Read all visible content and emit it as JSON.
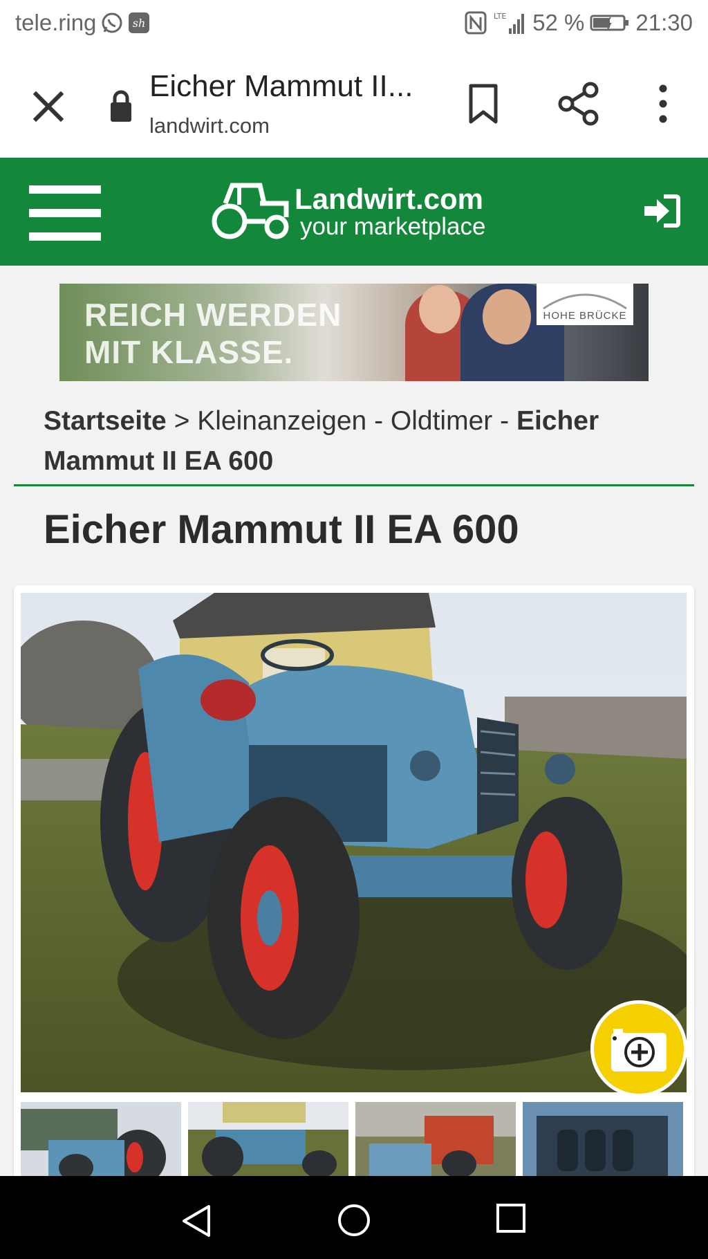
{
  "status_bar": {
    "carrier": "tele.ring",
    "battery": "52 %",
    "time": "21:30",
    "network": "LTE"
  },
  "browser": {
    "title": "Eicher Mammut II...",
    "host": "landwirt.com"
  },
  "site": {
    "logo_name": "Landwirt.com",
    "logo_tagline": "your marketplace",
    "brand_color": "#13883a"
  },
  "ad": {
    "headline_line1": "REICH WERDEN",
    "headline_line2": "MIT KLASSE.",
    "brand": "HOHE BRÜCKE"
  },
  "breadcrumb": {
    "home": "Startseite",
    "separator": ">",
    "category": "Kleinanzeigen - Oldtimer -",
    "current": "Eicher Mammut II EA 600"
  },
  "listing": {
    "title": "Eicher Mammut II EA 600",
    "thumbnail_count": 4,
    "camera_button_color": "#f4d000"
  }
}
